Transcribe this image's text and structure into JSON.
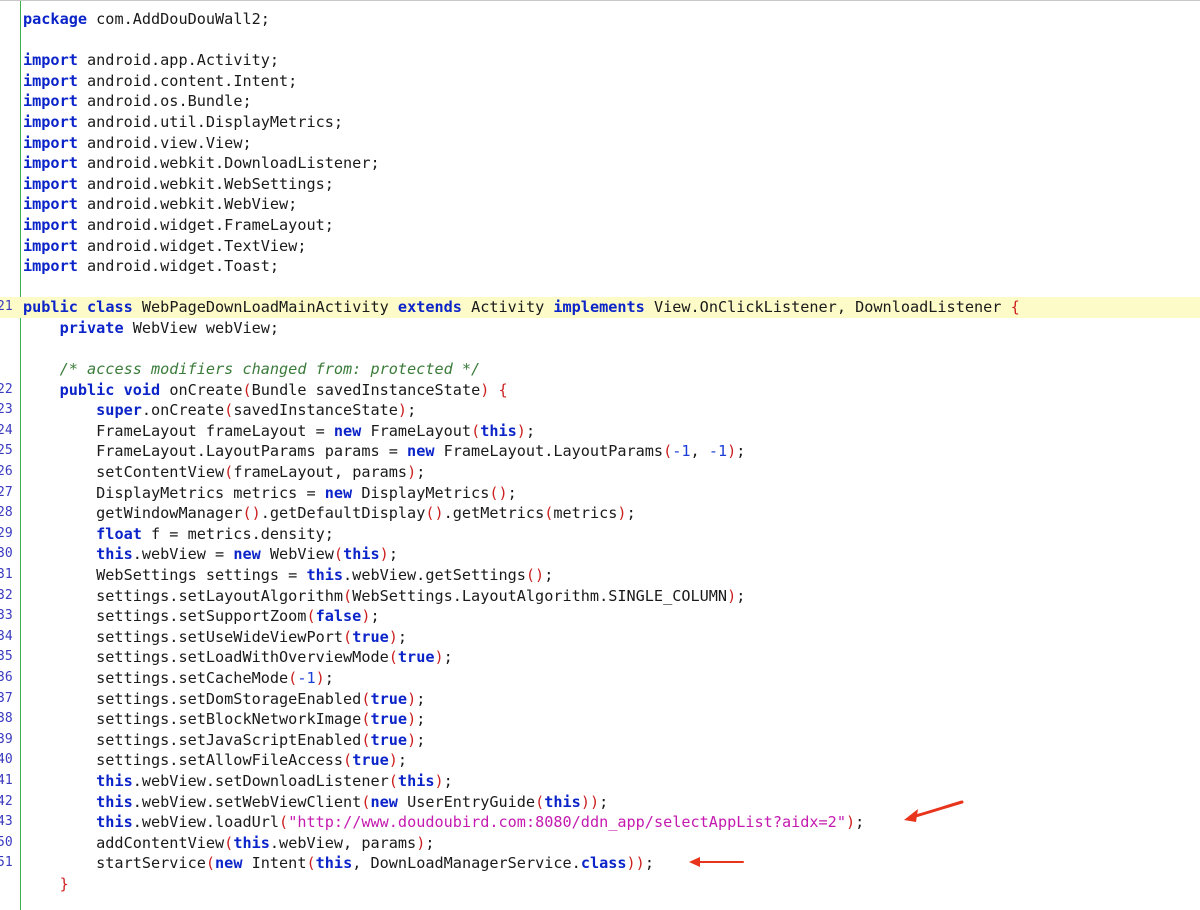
{
  "editor": {
    "lines": [
      {
        "ln": "",
        "tokens": [
          [
            "kw",
            "package"
          ],
          [
            "t",
            " com.AddDouDouWall2;"
          ]
        ]
      },
      {
        "ln": "",
        "tokens": []
      },
      {
        "ln": "",
        "tokens": [
          [
            "kw",
            "import"
          ],
          [
            "t",
            " android.app.Activity;"
          ]
        ]
      },
      {
        "ln": "",
        "tokens": [
          [
            "kw",
            "import"
          ],
          [
            "t",
            " android.content.Intent;"
          ]
        ]
      },
      {
        "ln": "",
        "tokens": [
          [
            "kw",
            "import"
          ],
          [
            "t",
            " android.os.Bundle;"
          ]
        ]
      },
      {
        "ln": "",
        "tokens": [
          [
            "kw",
            "import"
          ],
          [
            "t",
            " android.util.DisplayMetrics;"
          ]
        ]
      },
      {
        "ln": "",
        "tokens": [
          [
            "kw",
            "import"
          ],
          [
            "t",
            " android.view.View;"
          ]
        ]
      },
      {
        "ln": "",
        "tokens": [
          [
            "kw",
            "import"
          ],
          [
            "t",
            " android.webkit.DownloadListener;"
          ]
        ]
      },
      {
        "ln": "",
        "tokens": [
          [
            "kw",
            "import"
          ],
          [
            "t",
            " android.webkit.WebSettings;"
          ]
        ]
      },
      {
        "ln": "",
        "tokens": [
          [
            "kw",
            "import"
          ],
          [
            "t",
            " android.webkit.WebView;"
          ]
        ]
      },
      {
        "ln": "",
        "tokens": [
          [
            "kw",
            "import"
          ],
          [
            "t",
            " android.widget.FrameLayout;"
          ]
        ]
      },
      {
        "ln": "",
        "tokens": [
          [
            "kw",
            "import"
          ],
          [
            "t",
            " android.widget.TextView;"
          ]
        ]
      },
      {
        "ln": "",
        "tokens": [
          [
            "kw",
            "import"
          ],
          [
            "t",
            " android.widget.Toast;"
          ]
        ]
      },
      {
        "ln": "",
        "tokens": []
      },
      {
        "ln": "21",
        "hl": true,
        "tokens": [
          [
            "kw",
            "public"
          ],
          [
            "t",
            " "
          ],
          [
            "kw",
            "class"
          ],
          [
            "t",
            " WebPageDownLoadMainActivity "
          ],
          [
            "kw",
            "extends"
          ],
          [
            "t",
            " Activity "
          ],
          [
            "kw",
            "implements"
          ],
          [
            "t",
            " View.OnClickListener, DownloadListener "
          ],
          [
            "paren",
            "{"
          ]
        ]
      },
      {
        "ln": "",
        "tokens": [
          [
            "t",
            "    "
          ],
          [
            "kw",
            "private"
          ],
          [
            "t",
            " WebView webView;"
          ]
        ]
      },
      {
        "ln": "",
        "tokens": []
      },
      {
        "ln": "",
        "tokens": [
          [
            "t",
            "    "
          ],
          [
            "cmt",
            "/* access modifiers changed from: protected */"
          ]
        ]
      },
      {
        "ln": "22",
        "tokens": [
          [
            "t",
            "    "
          ],
          [
            "kw",
            "public"
          ],
          [
            "t",
            " "
          ],
          [
            "kw",
            "void"
          ],
          [
            "t",
            " onCreate"
          ],
          [
            "paren",
            "("
          ],
          [
            "t",
            "Bundle savedInstanceState"
          ],
          [
            "paren",
            ")"
          ],
          [
            "t",
            " "
          ],
          [
            "paren",
            "{"
          ]
        ]
      },
      {
        "ln": "23",
        "tokens": [
          [
            "t",
            "        "
          ],
          [
            "kw",
            "super"
          ],
          [
            "t",
            ".onCreate"
          ],
          [
            "paren",
            "("
          ],
          [
            "t",
            "savedInstanceState"
          ],
          [
            "paren",
            ")"
          ],
          [
            "t",
            ";"
          ]
        ]
      },
      {
        "ln": "24",
        "tokens": [
          [
            "t",
            "        FrameLayout frameLayout = "
          ],
          [
            "kw",
            "new"
          ],
          [
            "t",
            " FrameLayout"
          ],
          [
            "paren",
            "("
          ],
          [
            "kw",
            "this"
          ],
          [
            "paren",
            ")"
          ],
          [
            "t",
            ";"
          ]
        ]
      },
      {
        "ln": "25",
        "tokens": [
          [
            "t",
            "        FrameLayout.LayoutParams params = "
          ],
          [
            "kw",
            "new"
          ],
          [
            "t",
            " FrameLayout.LayoutParams"
          ],
          [
            "paren",
            "("
          ],
          [
            "num",
            "-1"
          ],
          [
            "t",
            ", "
          ],
          [
            "num",
            "-1"
          ],
          [
            "paren",
            ")"
          ],
          [
            "t",
            ";"
          ]
        ]
      },
      {
        "ln": "26",
        "tokens": [
          [
            "t",
            "        setContentView"
          ],
          [
            "paren",
            "("
          ],
          [
            "t",
            "frameLayout, params"
          ],
          [
            "paren",
            ")"
          ],
          [
            "t",
            ";"
          ]
        ]
      },
      {
        "ln": "27",
        "tokens": [
          [
            "t",
            "        DisplayMetrics metrics = "
          ],
          [
            "kw",
            "new"
          ],
          [
            "t",
            " DisplayMetrics"
          ],
          [
            "paren",
            "()"
          ],
          [
            "t",
            ";"
          ]
        ]
      },
      {
        "ln": "28",
        "tokens": [
          [
            "t",
            "        getWindowManager"
          ],
          [
            "paren",
            "()"
          ],
          [
            "t",
            ".getDefaultDisplay"
          ],
          [
            "paren",
            "()"
          ],
          [
            "t",
            ".getMetrics"
          ],
          [
            "paren",
            "("
          ],
          [
            "t",
            "metrics"
          ],
          [
            "paren",
            ")"
          ],
          [
            "t",
            ";"
          ]
        ]
      },
      {
        "ln": "29",
        "tokens": [
          [
            "t",
            "        "
          ],
          [
            "kw",
            "float"
          ],
          [
            "t",
            " f = metrics.density;"
          ]
        ]
      },
      {
        "ln": "30",
        "tokens": [
          [
            "t",
            "        "
          ],
          [
            "kw",
            "this"
          ],
          [
            "t",
            ".webView = "
          ],
          [
            "kw",
            "new"
          ],
          [
            "t",
            " WebView"
          ],
          [
            "paren",
            "("
          ],
          [
            "kw",
            "this"
          ],
          [
            "paren",
            ")"
          ],
          [
            "t",
            ";"
          ]
        ]
      },
      {
        "ln": "31",
        "tokens": [
          [
            "t",
            "        WebSettings settings = "
          ],
          [
            "kw",
            "this"
          ],
          [
            "t",
            ".webView.getSettings"
          ],
          [
            "paren",
            "()"
          ],
          [
            "t",
            ";"
          ]
        ]
      },
      {
        "ln": "32",
        "tokens": [
          [
            "t",
            "        settings.setLayoutAlgorithm"
          ],
          [
            "paren",
            "("
          ],
          [
            "t",
            "WebSettings.LayoutAlgorithm.SINGLE_COLUMN"
          ],
          [
            "paren",
            ")"
          ],
          [
            "t",
            ";"
          ]
        ]
      },
      {
        "ln": "33",
        "tokens": [
          [
            "t",
            "        settings.setSupportZoom"
          ],
          [
            "paren",
            "("
          ],
          [
            "kw",
            "false"
          ],
          [
            "paren",
            ")"
          ],
          [
            "t",
            ";"
          ]
        ]
      },
      {
        "ln": "34",
        "tokens": [
          [
            "t",
            "        settings.setUseWideViewPort"
          ],
          [
            "paren",
            "("
          ],
          [
            "kw",
            "true"
          ],
          [
            "paren",
            ")"
          ],
          [
            "t",
            ";"
          ]
        ]
      },
      {
        "ln": "35",
        "tokens": [
          [
            "t",
            "        settings.setLoadWithOverviewMode"
          ],
          [
            "paren",
            "("
          ],
          [
            "kw",
            "true"
          ],
          [
            "paren",
            ")"
          ],
          [
            "t",
            ";"
          ]
        ]
      },
      {
        "ln": "36",
        "tokens": [
          [
            "t",
            "        settings.setCacheMode"
          ],
          [
            "paren",
            "("
          ],
          [
            "num",
            "-1"
          ],
          [
            "paren",
            ")"
          ],
          [
            "t",
            ";"
          ]
        ]
      },
      {
        "ln": "37",
        "tokens": [
          [
            "t",
            "        settings.setDomStorageEnabled"
          ],
          [
            "paren",
            "("
          ],
          [
            "kw",
            "true"
          ],
          [
            "paren",
            ")"
          ],
          [
            "t",
            ";"
          ]
        ]
      },
      {
        "ln": "38",
        "tokens": [
          [
            "t",
            "        settings.setBlockNetworkImage"
          ],
          [
            "paren",
            "("
          ],
          [
            "kw",
            "true"
          ],
          [
            "paren",
            ")"
          ],
          [
            "t",
            ";"
          ]
        ]
      },
      {
        "ln": "39",
        "tokens": [
          [
            "t",
            "        settings.setJavaScriptEnabled"
          ],
          [
            "paren",
            "("
          ],
          [
            "kw",
            "true"
          ],
          [
            "paren",
            ")"
          ],
          [
            "t",
            ";"
          ]
        ]
      },
      {
        "ln": "40",
        "tokens": [
          [
            "t",
            "        settings.setAllowFileAccess"
          ],
          [
            "paren",
            "("
          ],
          [
            "kw",
            "true"
          ],
          [
            "paren",
            ")"
          ],
          [
            "t",
            ";"
          ]
        ]
      },
      {
        "ln": "41",
        "tokens": [
          [
            "t",
            "        "
          ],
          [
            "kw",
            "this"
          ],
          [
            "t",
            ".webView.setDownloadListener"
          ],
          [
            "paren",
            "("
          ],
          [
            "kw",
            "this"
          ],
          [
            "paren",
            ")"
          ],
          [
            "t",
            ";"
          ]
        ]
      },
      {
        "ln": "42",
        "tokens": [
          [
            "t",
            "        "
          ],
          [
            "kw",
            "this"
          ],
          [
            "t",
            ".webView.setWebViewClient"
          ],
          [
            "paren",
            "("
          ],
          [
            "kw",
            "new"
          ],
          [
            "t",
            " UserEntryGuide"
          ],
          [
            "paren",
            "("
          ],
          [
            "kw",
            "this"
          ],
          [
            "paren",
            "))"
          ],
          [
            "t",
            ";"
          ]
        ]
      },
      {
        "ln": "43",
        "tokens": [
          [
            "t",
            "        "
          ],
          [
            "kw",
            "this"
          ],
          [
            "t",
            ".webView.loadUrl"
          ],
          [
            "paren",
            "("
          ],
          [
            "str",
            "\"http://www.doudoubird.com:8080/ddn_app/selectAppList?aidx=2\""
          ],
          [
            "paren",
            ")"
          ],
          [
            "t",
            ";"
          ]
        ]
      },
      {
        "ln": "50",
        "tokens": [
          [
            "t",
            "        addContentView"
          ],
          [
            "paren",
            "("
          ],
          [
            "kw",
            "this"
          ],
          [
            "t",
            ".webView, params"
          ],
          [
            "paren",
            ")"
          ],
          [
            "t",
            ";"
          ]
        ]
      },
      {
        "ln": "51",
        "tokens": [
          [
            "t",
            "        startService"
          ],
          [
            "paren",
            "("
          ],
          [
            "kw",
            "new"
          ],
          [
            "t",
            " Intent"
          ],
          [
            "paren",
            "("
          ],
          [
            "kw",
            "this"
          ],
          [
            "t",
            ", DownLoadManagerService."
          ],
          [
            "kw",
            "class"
          ],
          [
            "paren",
            "))"
          ],
          [
            "t",
            ";"
          ]
        ]
      },
      {
        "ln": "",
        "tokens": [
          [
            "t",
            "    "
          ],
          [
            "paren",
            "}"
          ]
        ]
      }
    ]
  },
  "annotations": {
    "arrow_color": "#e8341c",
    "arrow_1_target": "loadUrl line",
    "arrow_2_target": "startService line"
  }
}
